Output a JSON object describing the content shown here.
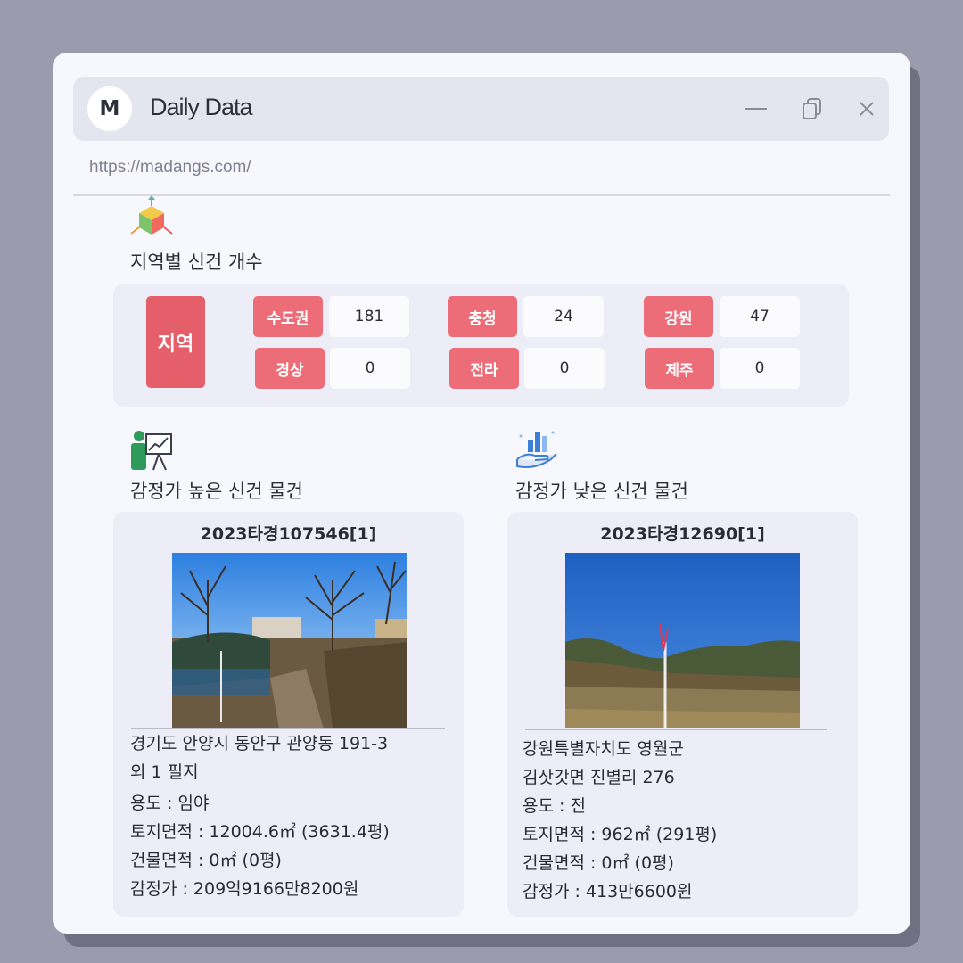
{
  "window": {
    "logo_letter": "M",
    "title": "Daily Data",
    "url": "https://madangs.com/"
  },
  "region_section": {
    "title": "지역별 신건 개수",
    "header_label": "지역",
    "items": [
      {
        "label": "수도권",
        "value": "181"
      },
      {
        "label": "충청",
        "value": "24"
      },
      {
        "label": "강원",
        "value": "47"
      },
      {
        "label": "경상",
        "value": "0"
      },
      {
        "label": "전라",
        "value": "0"
      },
      {
        "label": "제주",
        "value": "0"
      }
    ]
  },
  "high_section": {
    "title": "감정가 높은 신건 물건",
    "case_no": "2023타경107546[1]",
    "address_line1": "경기도 안양시 동안구 관양동 191-3",
    "address_line2": "외 1 필지",
    "usage": "용도 : 임야",
    "land_area": "토지면적 : 12004.6㎡ (3631.4평)",
    "building_area": "건물면적 : 0㎡ (0평)",
    "appraisal": "감정가 : 209억9166만8200원"
  },
  "low_section": {
    "title": "감정가 낮은 신건 물건",
    "case_no": "2023타경12690[1]",
    "address_line1": "강원특별자치도 영월군",
    "address_line2": "김삿갓면 진별리 276",
    "usage": "용도 : 전",
    "land_area": "토지면적 : 962㎡ (291평)",
    "building_area": "건물면적 : 0㎡ (0평)",
    "appraisal": "감정가 : 413만6600원"
  },
  "colors": {
    "accent_red": "#e45f6a",
    "label_red": "#ec6d77",
    "card_bg": "#ecedf6",
    "window_bg": "#f7f8fd"
  }
}
